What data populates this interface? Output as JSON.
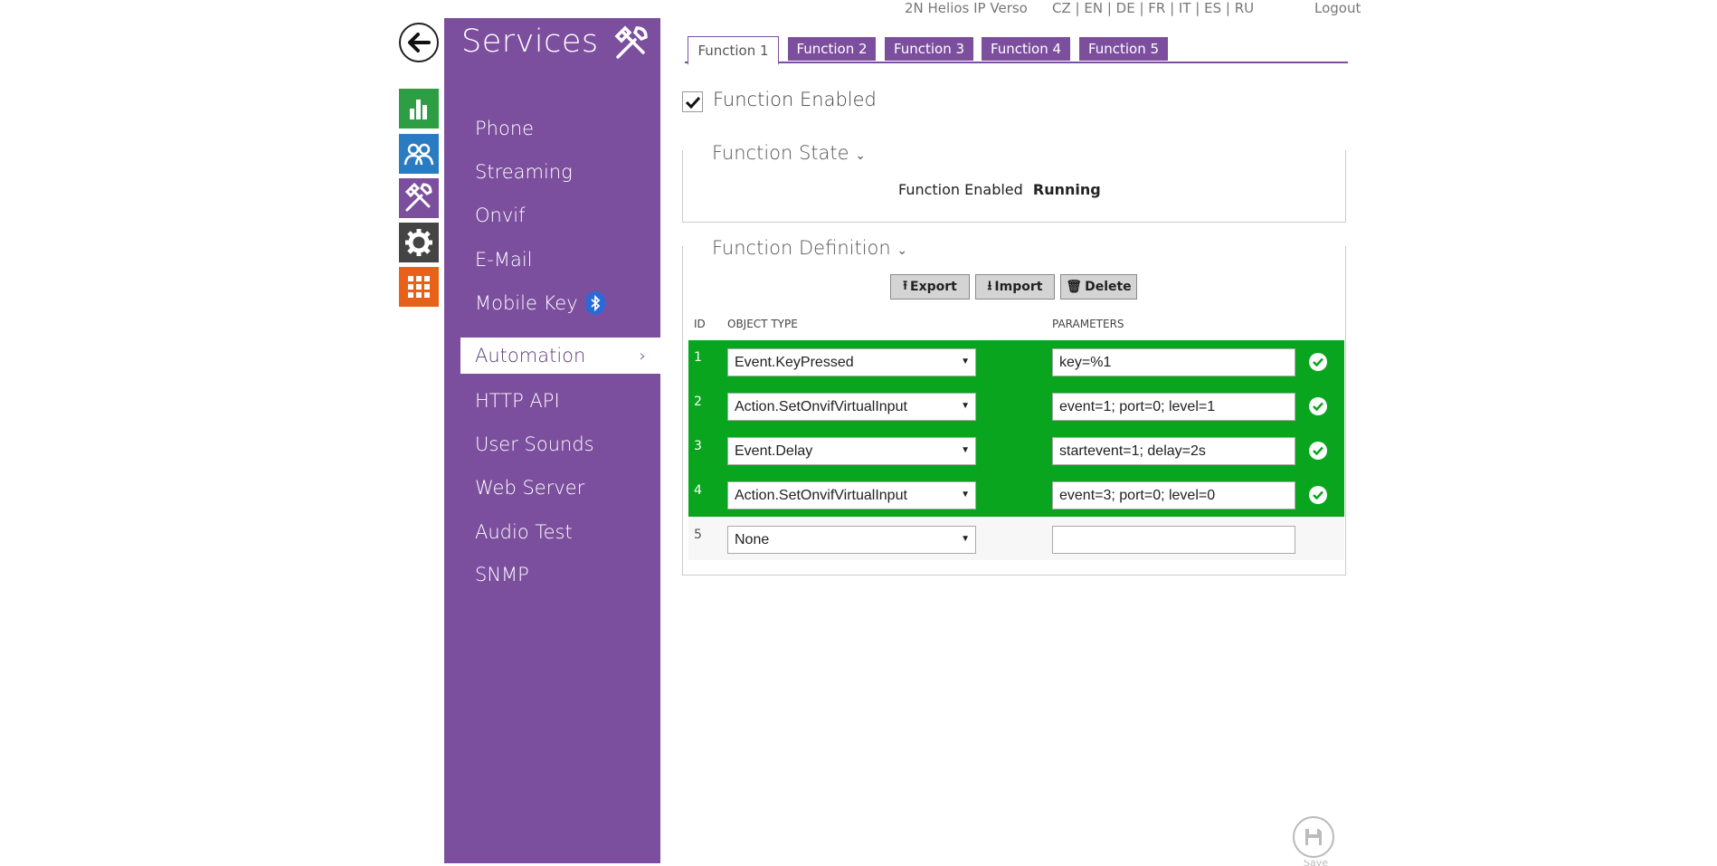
{
  "header": {
    "device": "2N Helios IP Verso",
    "languages": [
      "CZ",
      "EN",
      "DE",
      "FR",
      "IT",
      "ES",
      "RU"
    ],
    "logout": "Logout"
  },
  "sidebar": {
    "title": "Services",
    "items": [
      {
        "label": "Phone"
      },
      {
        "label": "Streaming"
      },
      {
        "label": "Onvif"
      },
      {
        "label": "E-Mail"
      },
      {
        "label": "Mobile Key"
      },
      {
        "label": "Automation",
        "active": true
      },
      {
        "label": "HTTP API"
      },
      {
        "label": "User Sounds"
      },
      {
        "label": "Web Server"
      },
      {
        "label": "Audio Test"
      },
      {
        "label": "SNMP"
      }
    ]
  },
  "leftbar": {
    "icons": [
      {
        "name": "status-icon",
        "color": "#2e9e44"
      },
      {
        "name": "directory-icon",
        "color": "#2a7cc2"
      },
      {
        "name": "services-icon",
        "color": "#7c4f9e"
      },
      {
        "name": "hardware-icon",
        "color": "#444444"
      },
      {
        "name": "system-icon",
        "color": "#e8611b"
      }
    ]
  },
  "tabs": [
    {
      "label": "Function 1",
      "active": true
    },
    {
      "label": "Function 2"
    },
    {
      "label": "Function 3"
    },
    {
      "label": "Function 4"
    },
    {
      "label": "Function 5"
    }
  ],
  "function_enabled": {
    "label": "Function Enabled",
    "checked": true
  },
  "function_state": {
    "title": "Function State",
    "status_label": "Function Enabled",
    "status_value": "Running"
  },
  "function_definition": {
    "title": "Function Definition",
    "buttons": {
      "export": "Export",
      "import": "Import",
      "delete": "Delete"
    },
    "columns": {
      "id": "ID",
      "object_type": "OBJECT TYPE",
      "parameters": "PARAMETERS"
    },
    "rows": [
      {
        "id": "1",
        "object_type": "Event.KeyPressed",
        "parameters": "key=%1",
        "valid": true
      },
      {
        "id": "2",
        "object_type": "Action.SetOnvifVirtualInput",
        "parameters": "event=1; port=0; level=1",
        "valid": true
      },
      {
        "id": "3",
        "object_type": "Event.Delay",
        "parameters": "startevent=1; delay=2s",
        "valid": true
      },
      {
        "id": "4",
        "object_type": "Action.SetOnvifVirtualInput",
        "parameters": "event=3; port=0; level=0",
        "valid": true
      },
      {
        "id": "5",
        "object_type": "None",
        "parameters": "",
        "valid": false
      }
    ]
  },
  "save": {
    "label": "Save"
  },
  "colors": {
    "accent": "#7c4f9e",
    "valid_row": "#0aa51e"
  }
}
